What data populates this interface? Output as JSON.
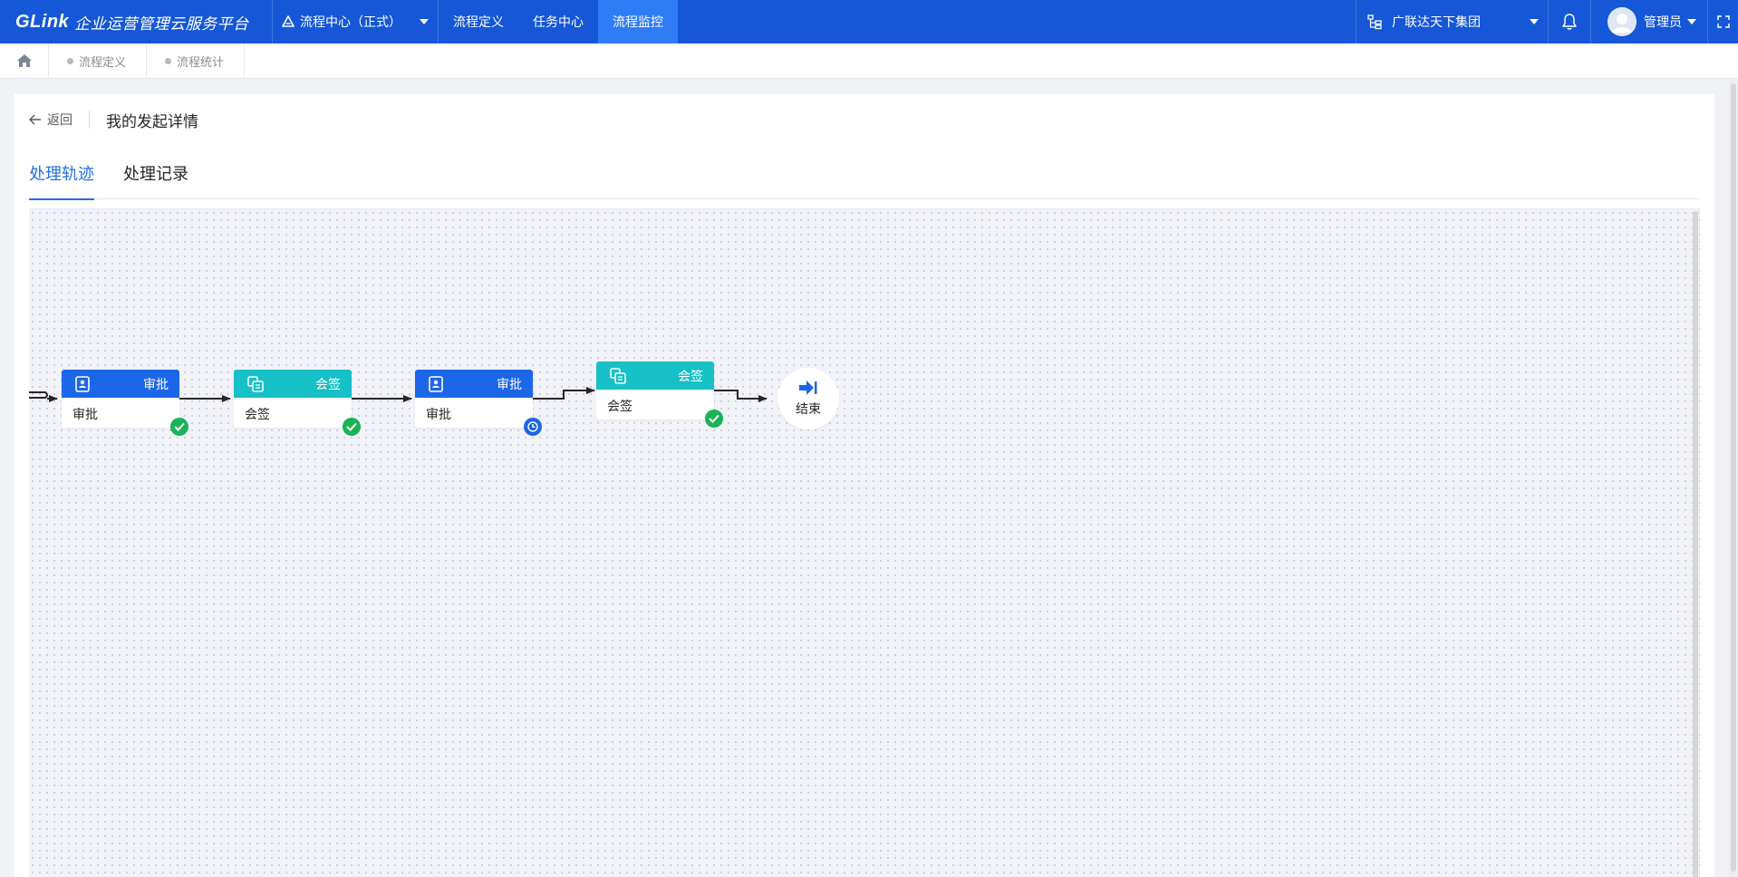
{
  "brand": {
    "logo": "GLink",
    "name": "企业运营管理云服务平台"
  },
  "center_switch": {
    "label": "流程中心（正式）"
  },
  "nav": [
    {
      "label": "流程定义",
      "active": false
    },
    {
      "label": "任务中心",
      "active": false
    },
    {
      "label": "流程监控",
      "active": true
    }
  ],
  "org": {
    "label": "广联达天下集团"
  },
  "user": {
    "name": "管理员"
  },
  "tags": [
    {
      "label": "流程定义"
    },
    {
      "label": "流程统计"
    }
  ],
  "page": {
    "back_label": "返回",
    "title": "我的发起详情"
  },
  "tabs": [
    {
      "label": "处理轨迹",
      "active": true
    },
    {
      "label": "处理记录",
      "active": false
    }
  ],
  "flow": {
    "nodes": [
      {
        "type_label": "审批",
        "name": "审批",
        "kind": "approve",
        "status": "done"
      },
      {
        "type_label": "会签",
        "name": "会签",
        "kind": "countersign",
        "status": "done"
      },
      {
        "type_label": "审批",
        "name": "审批",
        "kind": "approve",
        "status": "pending"
      },
      {
        "type_label": "会签",
        "name": "会签",
        "kind": "countersign",
        "status": "done"
      }
    ],
    "end_label": "结束"
  },
  "colors": {
    "topbar": "#1557d6",
    "nav_active": "#2f7cf6",
    "approve": "#1c66e8",
    "countersign": "#16c0c6",
    "done": "#19b257",
    "pending": "#1c66e8",
    "tab_active": "#1f6feb"
  }
}
